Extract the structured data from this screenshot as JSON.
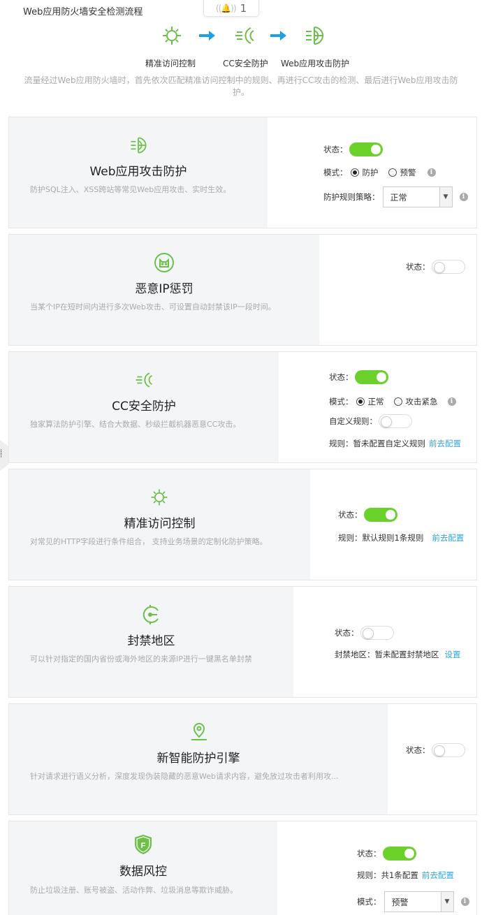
{
  "header": {
    "title": "Web应用防火墙安全检测流程",
    "notification_count": "1"
  },
  "flow": {
    "steps": [
      {
        "label": "精准访问控制",
        "icon": "gear-shield-icon"
      },
      {
        "label": "CC安全防护",
        "icon": "cc-wave-icon"
      },
      {
        "label": "Web应用攻击防护",
        "icon": "globe-shield-icon"
      }
    ],
    "description": "流量经过Web应用防火墙时，首先依次匹配精准访问控制中的规则、再进行CC攻击的检测、最后进行Web应用攻击防护。"
  },
  "cards": {
    "web": {
      "title": "Web应用攻击防护",
      "desc": "防护SQL注入、XSS跨站等常见Web应用攻击、实时生效。",
      "status_label": "状态：",
      "status": "on",
      "mode_label": "模式：",
      "mode_options": [
        "防护",
        "预警"
      ],
      "strategy_label": "防护规则策略：",
      "strategy_value": "正常"
    },
    "ip": {
      "title": "恶意IP惩罚",
      "desc": "当某个IP在短时间内进行多次Web攻击、可设置自动封禁该IP一段时间。",
      "status_label": "状态：",
      "status": "off"
    },
    "cc": {
      "title": "CC安全防护",
      "desc": "独家算法防护引擎、结合大数据、秒级拦截机器恶意CC攻击。",
      "status_label": "状态：",
      "status": "on",
      "mode_label": "模式：",
      "mode_options": [
        "正常",
        "攻击紧急"
      ],
      "custom_label": "自定义规则：",
      "rule_label": "规则：",
      "rule_value": "暂未配置自定义规则",
      "rule_link": "前去配置"
    },
    "acl": {
      "title": "精准访问控制",
      "desc": "对常见的HTTP字段进行条件组合， 支持业务场景的定制化防护策略。",
      "status_label": "状态：",
      "status": "on",
      "rule_label": "规则：",
      "rule_value": "默认规则1条规则",
      "rule_link": "前去配置"
    },
    "region": {
      "title": "封禁地区",
      "desc": "可以针对指定的国内省份或海外地区的来源IP进行一键黑名单封禁",
      "status_label": "状态：",
      "status": "off",
      "rule_label": "封禁地区：",
      "rule_value": "暂未配置封禁地区",
      "rule_link": "设置"
    },
    "ai": {
      "title": "新智能防护引擎",
      "desc": "针对请求进行语义分析，深度发现伪装隐藏的恶意Web请求内容，避免放过攻击者利用攻...",
      "status_label": "状态：",
      "status": "off"
    },
    "risk": {
      "title": "数据风控",
      "desc": "防止垃圾注册、账号被盗、活动作弊、垃圾消息等欺诈威胁。",
      "status_label": "状态：",
      "status": "on",
      "rule_label": "规则：",
      "rule_value": "共1条配置",
      "rule_link": "前去配置",
      "mode_label": "模式：",
      "mode_value": "预警"
    }
  },
  "colors": {
    "accent": "#6ad12a",
    "link": "#2fa6e2",
    "icon": "#6cc04a"
  }
}
